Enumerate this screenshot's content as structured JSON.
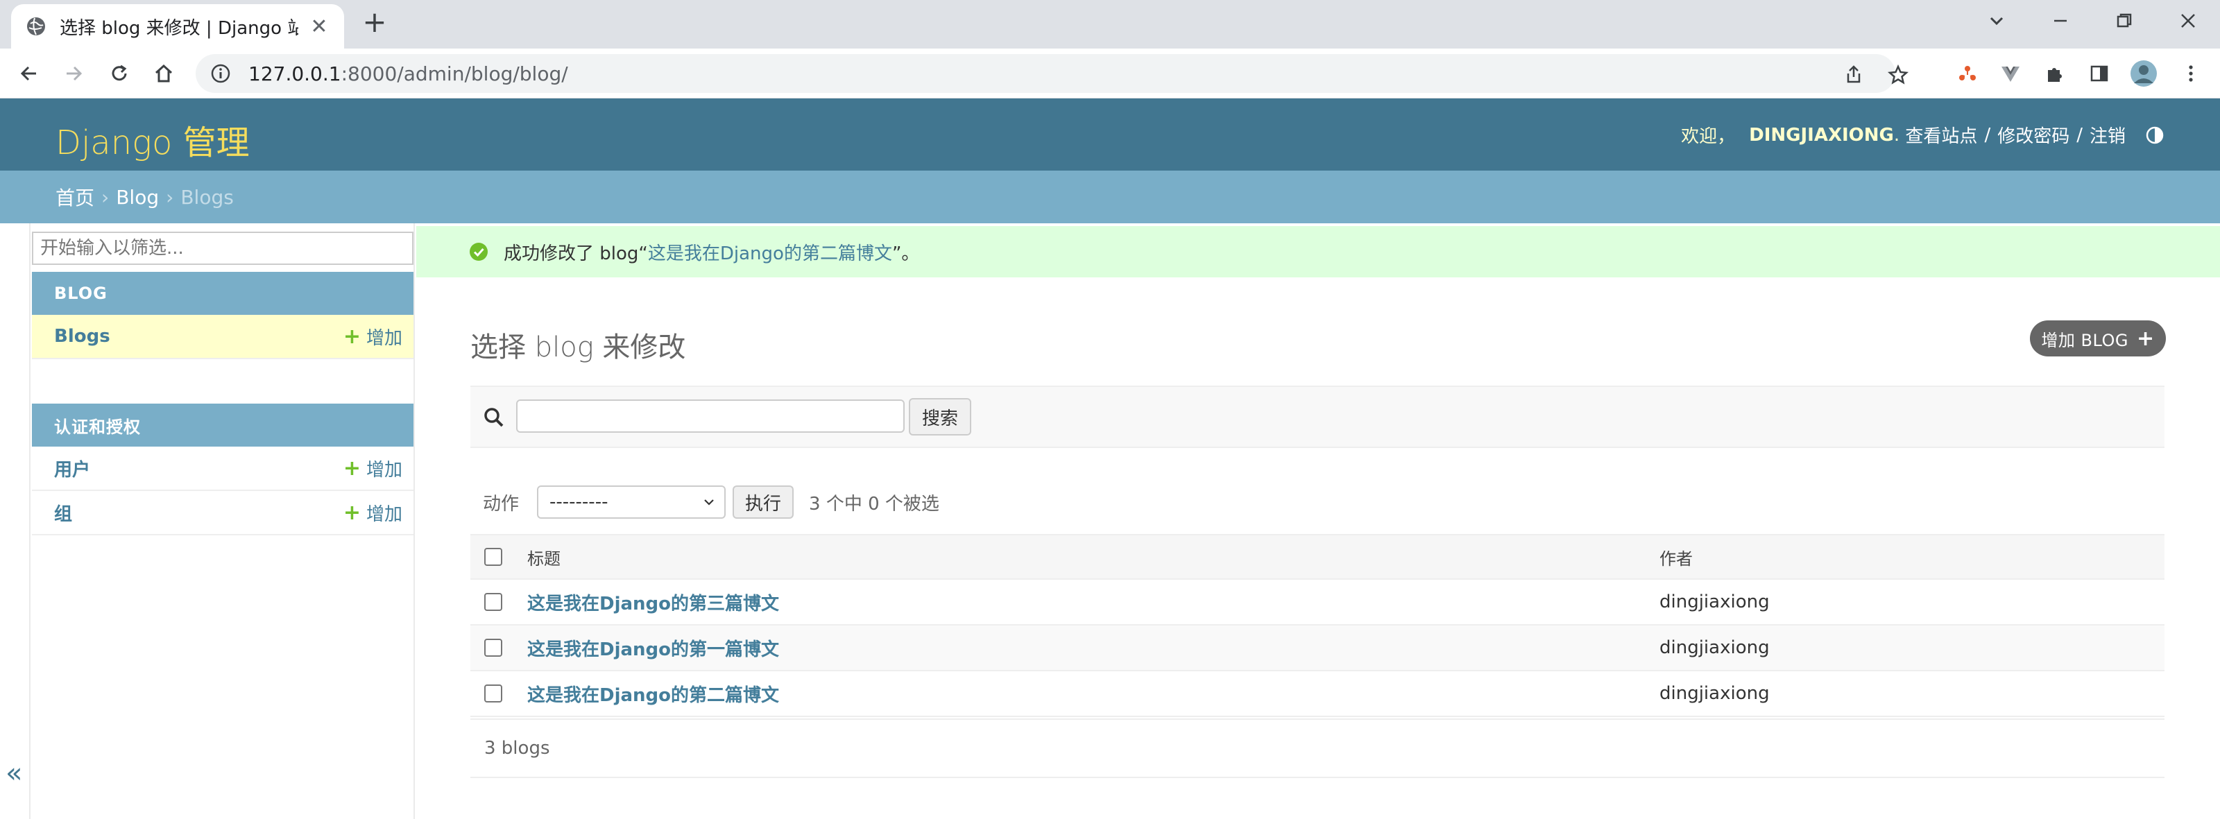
{
  "browser": {
    "tab_title": "选择 blog 来修改 | Django 站点",
    "url_host": "127.0.0.1",
    "url_path": ":8000/admin/blog/blog/"
  },
  "header": {
    "branding": "Django 管理",
    "welcome": "欢迎，",
    "username": "DINGJIAXIONG",
    "view_site": "查看站点",
    "change_password": "修改密码",
    "logout": "注销"
  },
  "breadcrumbs": {
    "home": "首页",
    "app": "Blog",
    "current": "Blogs"
  },
  "sidebar": {
    "filter_placeholder": "开始输入以筛选...",
    "modules": [
      {
        "caption": "BLOG",
        "rows": [
          {
            "name": "Blogs",
            "add": "增加"
          }
        ]
      },
      {
        "caption": "认证和授权",
        "rows": [
          {
            "name": "用户",
            "add": "增加"
          },
          {
            "name": "组",
            "add": "增加"
          }
        ]
      }
    ],
    "collapse_symbol": "«"
  },
  "message": {
    "prefix": "成功修改了 blog“",
    "link": "这是我在Django的第二篇博文",
    "suffix": "”。"
  },
  "content": {
    "title": "选择 blog 来修改",
    "add_button": "增加 BLOG",
    "search_button": "搜索",
    "search_value": "",
    "action_label": "动作",
    "action_selected": "---------",
    "execute_button": "执行",
    "counter": "3 个中 0 个被选",
    "columns": {
      "title": "标题",
      "author": "作者"
    },
    "rows": [
      {
        "title": "这是我在Django的第三篇博文",
        "author": "dingjiaxiong"
      },
      {
        "title": "这是我在Django的第一篇博文",
        "author": "dingjiaxiong"
      },
      {
        "title": "这是我在Django的第二篇博文",
        "author": "dingjiaxiong"
      }
    ],
    "paginator": "3 blogs"
  },
  "colors": {
    "header_bg": "#417690",
    "breadcrumb_bg": "#79aec8",
    "branding": "#f5dd5d",
    "link": "#447e9b",
    "success_bg": "#ddffdd",
    "add_plus": "#70bf2b"
  }
}
